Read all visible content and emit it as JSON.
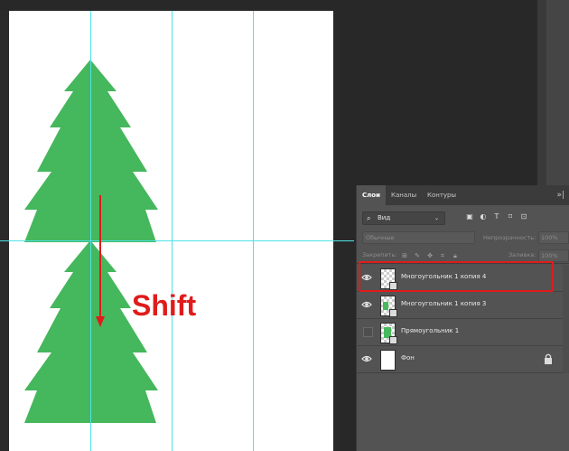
{
  "annotation": {
    "shift_label": "Shift",
    "arrow_color": "#e01b1b"
  },
  "canvas": {
    "background": "#ffffff",
    "tree_color": "#45b75c",
    "guide_color": "#4fe2e6"
  },
  "layers_panel": {
    "tabs": [
      "Слои",
      "Каналы",
      "Контуры"
    ],
    "active_tab": "Слои",
    "menu_glyph": "»|",
    "filter": {
      "label": "Вид",
      "icons": [
        "image-filter-icon",
        "adjustment-filter-icon",
        "type-filter-icon",
        "shape-filter-icon",
        "smart-object-filter-icon"
      ]
    },
    "blend_mode": "Обычные",
    "opacity_label": "Непрозрачность:",
    "opacity_value": "100%",
    "lock_label": "Закрепить:",
    "fill_label": "Заливка:",
    "fill_value": "100%",
    "layers": [
      {
        "name": "Многоугольник 1 копия 4",
        "visible": true,
        "selected": true,
        "thumb": "vector"
      },
      {
        "name": "Многоугольник 1 копия 3",
        "visible": true,
        "selected": false,
        "thumb": "vector"
      },
      {
        "name": "Прямоугольник 1",
        "visible": false,
        "selected": false,
        "thumb": "vector"
      },
      {
        "name": "Фон",
        "visible": true,
        "selected": false,
        "thumb": "background",
        "locked": true
      }
    ]
  }
}
